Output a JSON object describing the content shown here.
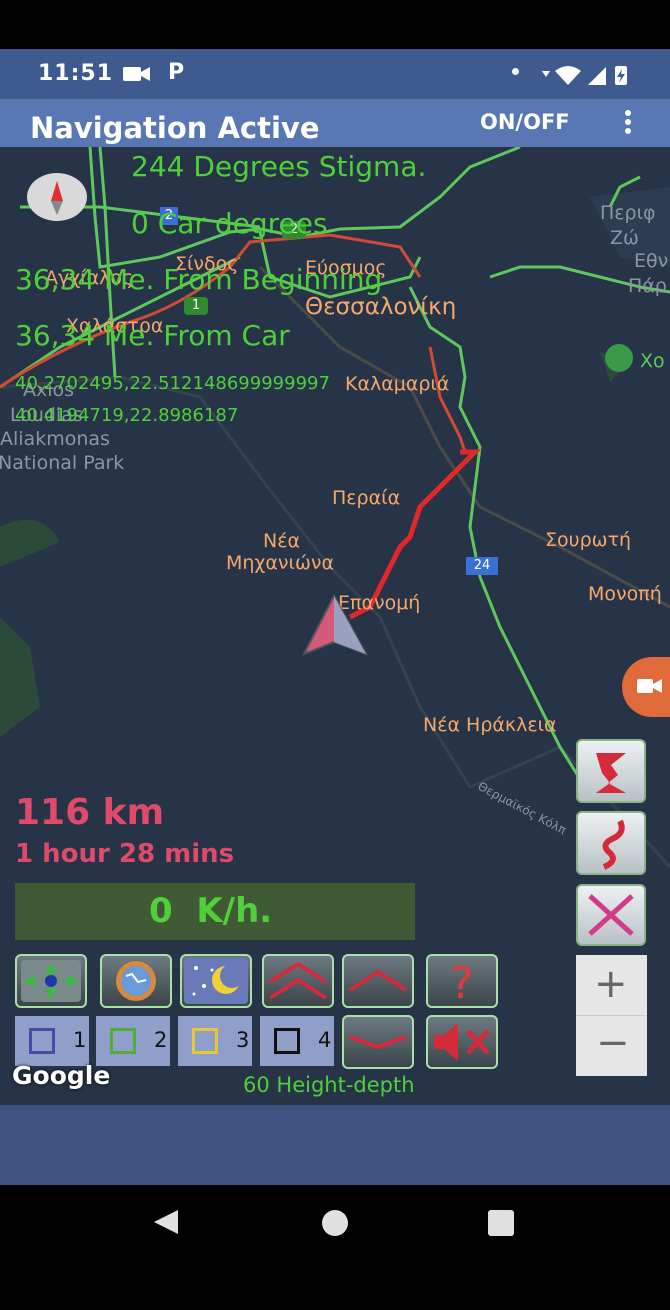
{
  "status_bar": {
    "time": "11:51",
    "app_badge": "P"
  },
  "app_bar": {
    "title": "Navigation Active",
    "toggle_label": "ON/OFF"
  },
  "overlay": {
    "bearing": "244 Degrees Stigma.",
    "car_degrees": "0 Car degrees",
    "from_beginning": "36,34 Me. From Beginning",
    "from_car": "36,34 Me. From Car",
    "coords_1": "40,2702495,22.512148699999997",
    "coords_2": "40.4194719,22.8986187"
  },
  "map_labels": {
    "sindos": "Σίνδος",
    "efosmos": "Εύοσμος",
    "thessaloniki": "Θεσσαλονίκη",
    "chalastra": "Χαλάστρα",
    "anchialos": "Αγχίαλος",
    "kalamaria": "Καλαμαριά",
    "peraia": "Περαία",
    "nea": "Νέα",
    "michaniona": "Μηχανιώνα",
    "epanomi": "Επανομή",
    "sourotí": "Σουρωτή",
    "monopigado": "Μονοπή",
    "nea_irakleia": "Νέα Ηράκλεια",
    "perif": "Περιφ",
    "zoni": "Ζώ",
    "ethn": "Εθν",
    "park": "Πάρ",
    "chort": "Χο",
    "axios": "Axios",
    "loudias": "Loudias",
    "aliakmonas": "Aliakmonas",
    "national_park": "National Park",
    "thermaikos": "Θερμαϊκός Κόλπ",
    "shield_2": "2",
    "shield_2b": "2",
    "shield_1": "1",
    "shield_24": "24"
  },
  "trip": {
    "distance": "116 km",
    "duration": "1 hour 28 mins",
    "speed": "0  K/h."
  },
  "checkboxes": [
    {
      "num": "1",
      "color": "#3f4fa8"
    },
    {
      "num": "2",
      "color": "#4fae3a"
    },
    {
      "num": "3",
      "color": "#e4c83a"
    },
    {
      "num": "4",
      "color": "#111111"
    }
  ],
  "zoom": {
    "in": "+",
    "out": "−"
  },
  "height_depth": "60 Height-depth",
  "google": "Google"
}
